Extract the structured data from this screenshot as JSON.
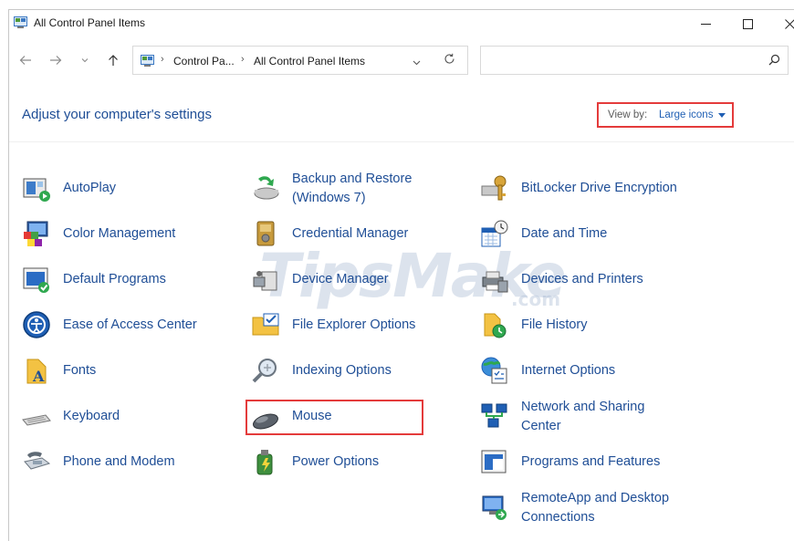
{
  "window": {
    "title": "All Control Panel Items"
  },
  "address": {
    "segments": [
      "Control Pa...",
      "All Control Panel Items"
    ],
    "search_placeholder": ""
  },
  "header": {
    "title": "Adjust your computer's settings",
    "view_by_label": "View by:",
    "view_by_value": "Large icons"
  },
  "items": [
    [
      "AutoPlay"
    ],
    [
      "Backup and Restore",
      "(Windows 7)"
    ],
    [
      "BitLocker Drive Encryption"
    ],
    [
      "Color Management"
    ],
    [
      "Credential Manager"
    ],
    [
      "Date and Time"
    ],
    [
      "Default Programs"
    ],
    [
      "Device Manager"
    ],
    [
      "Devices and Printers"
    ],
    [
      "Ease of Access Center"
    ],
    [
      "File Explorer Options"
    ],
    [
      "File History"
    ],
    [
      "Fonts"
    ],
    [
      "Indexing Options"
    ],
    [
      "Internet Options"
    ],
    [
      "Keyboard"
    ],
    [
      "Mouse"
    ],
    [
      "Network and Sharing",
      "Center"
    ],
    [
      "Phone and Modem"
    ],
    [
      "Power Options"
    ],
    [
      "Programs and Features"
    ],
    [
      "RemoteApp and Desktop",
      "Connections"
    ]
  ],
  "watermark": {
    "text": "TipsMake",
    "suffix": ".com"
  },
  "colors": {
    "link": "#1f4e96",
    "highlight": "#e43b3b",
    "view_value": "#1f5fb4"
  }
}
